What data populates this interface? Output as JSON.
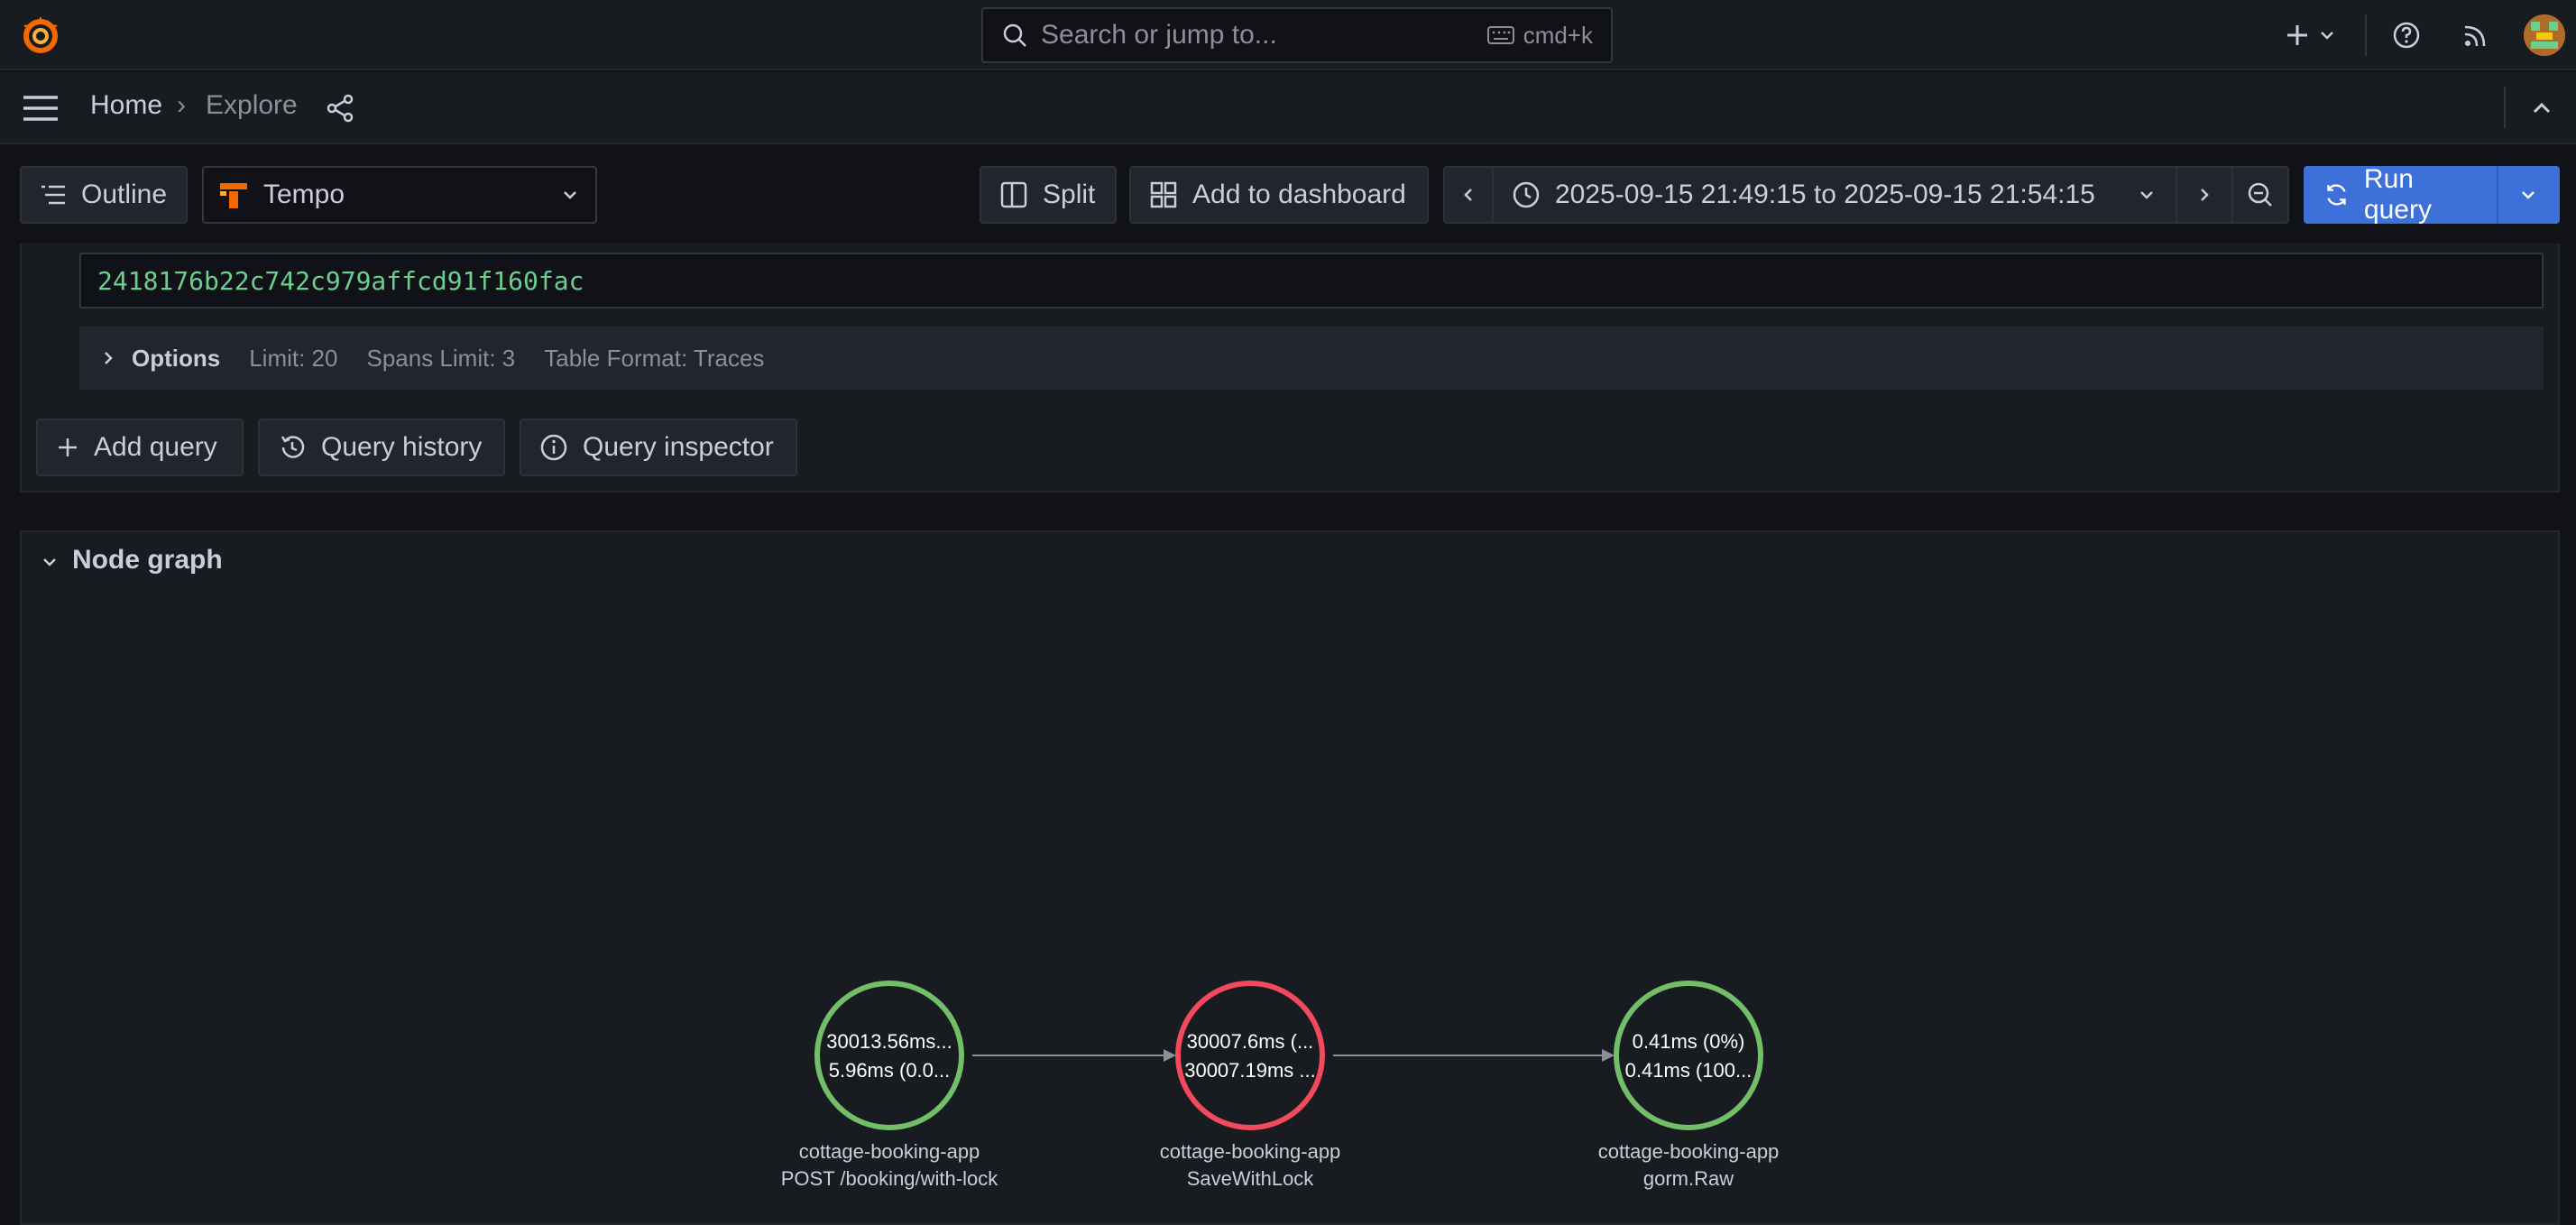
{
  "topbar": {
    "search_placeholder": "Search or jump to...",
    "search_shortcut": "cmd+k"
  },
  "breadcrumb": {
    "home": "Home",
    "separator": "›",
    "current": "Explore"
  },
  "toolbar": {
    "outline_label": "Outline",
    "datasource": "Tempo",
    "split_label": "Split",
    "add_to_dashboard_label": "Add to dashboard",
    "time_range": "2025-09-15 21:49:15 to 2025-09-15 21:54:15",
    "run_query_label": "Run query"
  },
  "query": {
    "trace_id": "2418176b22c742c979affcd91f160fac",
    "options_title": "Options",
    "limit": "Limit: 20",
    "spans_limit": "Spans Limit: 3",
    "table_format": "Table Format: Traces",
    "add_query_label": "Add query",
    "query_history_label": "Query history",
    "query_inspector_label": "Query inspector"
  },
  "node_graph": {
    "title": "Node graph",
    "nodes": [
      {
        "stat1": "30013.56ms...",
        "stat2": "5.96ms (0.0...",
        "service": "cottage-booking-app",
        "operation": "POST /booking/with-lock",
        "status_color": "#73bf69"
      },
      {
        "stat1": "30007.6ms (...",
        "stat2": "30007.19ms ...",
        "service": "cottage-booking-app",
        "operation": "SaveWithLock",
        "status_color": "#f2495c"
      },
      {
        "stat1": "0.41ms (0%)",
        "stat2": "0.41ms (100...",
        "service": "cottage-booking-app",
        "operation": "gorm.Raw",
        "status_color": "#73bf69"
      }
    ]
  },
  "colors": {
    "accent": "#3d71d9",
    "ok": "#73bf69",
    "error": "#f2495c",
    "trace_id_text": "#6ccf8e"
  }
}
